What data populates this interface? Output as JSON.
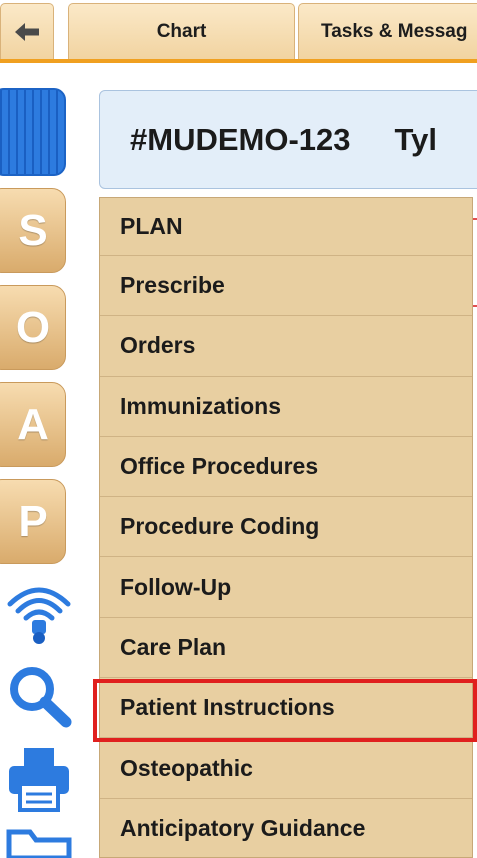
{
  "tabs": {
    "back_icon": "arrow-left-icon",
    "chart_label": "Chart",
    "tasks_label": "Tasks & Messag"
  },
  "rail": {
    "soap_letters": [
      "S",
      "O",
      "A",
      "P"
    ],
    "icons": [
      "stethoscope-icon",
      "search-icon",
      "printer-icon",
      "folder-icon"
    ]
  },
  "patient": {
    "id": "#MUDEMO-123",
    "name_partial": "Tyl"
  },
  "menu": {
    "items": [
      "PLAN",
      "Prescribe",
      "Orders",
      "Immunizations",
      "Office Procedures",
      "Procedure Coding",
      "Follow-Up",
      "Care Plan",
      "Patient Instructions",
      "Osteopathic",
      "Anticipatory Guidance"
    ],
    "highlighted_item": "Patient Instructions"
  },
  "colors": {
    "accent_orange": "#f0a020",
    "menu_bg": "#e8cfa1",
    "highlight_red": "#e0201e",
    "rail_blue": "#1a5fc2"
  }
}
